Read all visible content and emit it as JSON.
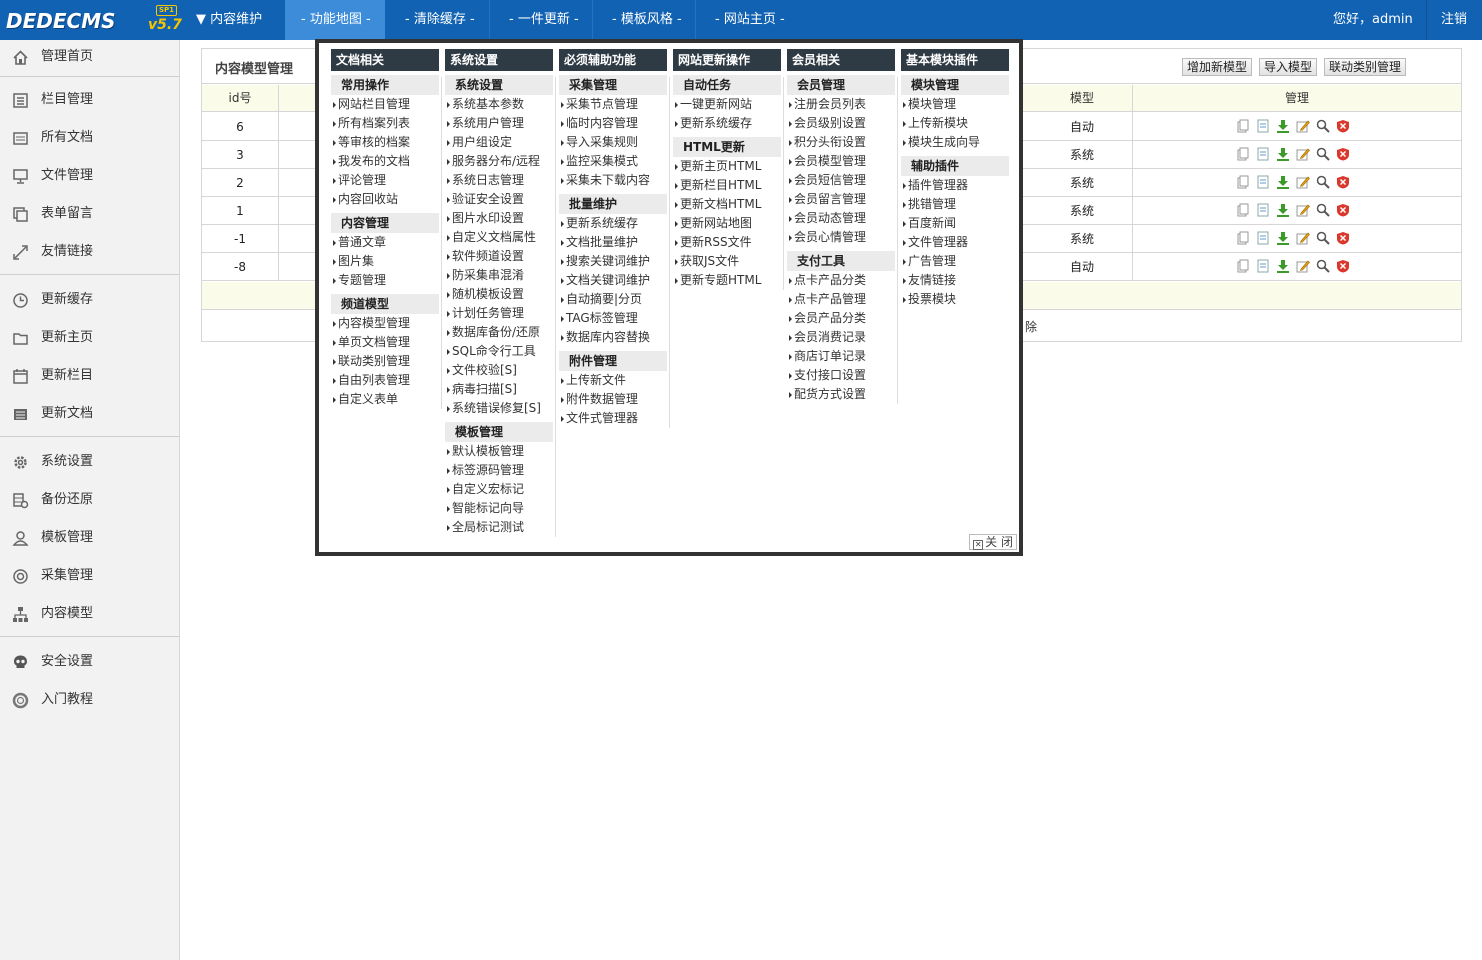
{
  "topbar": {
    "logo_text": "DEDECMS",
    "logo_version": "v5.7",
    "logo_badge": "SP1",
    "nav": [
      {
        "label": "▼ 内容维护",
        "active": false
      },
      {
        "label": "- 功能地图 -",
        "active": true
      },
      {
        "label": "- 清除缓存 -",
        "active": false
      },
      {
        "label": "- 一件更新 -",
        "active": false
      },
      {
        "label": "- 模板风格 -",
        "active": false
      },
      {
        "label": "- 网站主页 -",
        "active": false
      }
    ],
    "greeting": "您好，admin",
    "logout": "注销",
    "colors": {
      "bar": "#1162b3",
      "active": "#3d8cd9"
    }
  },
  "sidebar": {
    "items": [
      {
        "label": "管理首页",
        "icon": "home-icon"
      },
      {
        "label": "栏目管理",
        "icon": "columns-icon"
      },
      {
        "label": "所有文档",
        "icon": "documents-icon"
      },
      {
        "label": "文件管理",
        "icon": "monitor-icon"
      },
      {
        "label": "表单留言",
        "icon": "forms-icon"
      },
      {
        "label": "友情链接",
        "icon": "link-icon"
      },
      {
        "label": "更新缓存",
        "icon": "clock-icon"
      },
      {
        "label": "更新主页",
        "icon": "folder-icon"
      },
      {
        "label": "更新栏目",
        "icon": "calendar-icon"
      },
      {
        "label": "更新文档",
        "icon": "list-icon"
      },
      {
        "label": "系统设置",
        "icon": "gear-icon"
      },
      {
        "label": "备份还原",
        "icon": "database-icon"
      },
      {
        "label": "模板管理",
        "icon": "user-icon"
      },
      {
        "label": "采集管理",
        "icon": "collect-icon"
      },
      {
        "label": "内容模型",
        "icon": "sitemap-icon"
      },
      {
        "label": "安全设置",
        "icon": "skull-icon"
      },
      {
        "label": "入门教程",
        "icon": "help-icon"
      }
    ]
  },
  "main": {
    "title": "内容模型管理",
    "buttons": {
      "add": "增加新模型",
      "import": "导入模型",
      "linkage": "联动类别管理"
    },
    "headers": {
      "id": "id号",
      "model": "模型",
      "manage": "管理"
    },
    "rows": [
      {
        "id": "6",
        "model": "自动"
      },
      {
        "id": "3",
        "model": "系统"
      },
      {
        "id": "2",
        "model": "系统"
      },
      {
        "id": "1",
        "model": "系统"
      },
      {
        "id": "-1",
        "model": "系统"
      },
      {
        "id": "-8",
        "model": "自动"
      }
    ],
    "row_action_icons": [
      "copy-icon",
      "view-icon",
      "download-icon",
      "edit-icon",
      "search-icon",
      "delete-icon"
    ],
    "hidden_fragment": "除"
  },
  "popup": {
    "close_label": "关 闭",
    "columns": [
      {
        "title": "文档相关",
        "groups": [
          {
            "title": "常用操作",
            "items": [
              "网站栏目管理",
              "所有档案列表",
              "等审核的档案",
              "我发布的文档",
              "评论管理",
              "内容回收站"
            ]
          },
          {
            "title": "内容管理",
            "items": [
              "普通文章",
              "图片集",
              "专题管理"
            ]
          },
          {
            "title": "频道模型",
            "items": [
              "内容模型管理",
              "单页文档管理",
              "联动类别管理",
              "自由列表管理",
              "自定义表单"
            ]
          }
        ]
      },
      {
        "title": "系统设置",
        "groups": [
          {
            "title": "系统设置",
            "items": [
              "系统基本参数",
              "系统用户管理",
              "用户组设定",
              "服务器分布/远程",
              "系统日志管理",
              "验证安全设置",
              "图片水印设置",
              "自定义文档属性",
              "软件频道设置",
              "防采集串混淆",
              "随机模板设置",
              "计划任务管理",
              "数据库备份/还原",
              "SQL命令行工具",
              "文件校验[S]",
              "病毒扫描[S]",
              "系统错误修复[S]"
            ]
          },
          {
            "title": "模板管理",
            "items": [
              "默认模板管理",
              "标签源码管理",
              "自定义宏标记",
              "智能标记向导",
              "全局标记测试"
            ]
          }
        ]
      },
      {
        "title": "必须辅助功能",
        "groups": [
          {
            "title": "采集管理",
            "items": [
              "采集节点管理",
              "临时内容管理",
              "导入采集规则",
              "监控采集模式",
              "采集未下载内容"
            ]
          },
          {
            "title": "批量维护",
            "items": [
              "更新系统缓存",
              "文档批量维护",
              "搜索关键词维护",
              "文档关键词维护",
              "自动摘要|分页",
              "TAG标签管理",
              "数据库内容替换"
            ]
          },
          {
            "title": "附件管理",
            "items": [
              "上传新文件",
              "附件数据管理",
              "文件式管理器"
            ]
          }
        ]
      },
      {
        "title": "网站更新操作",
        "groups": [
          {
            "title": "自动任务",
            "items": [
              "一键更新网站",
              "更新系统缓存"
            ]
          },
          {
            "title": "HTML更新",
            "items": [
              "更新主页HTML",
              "更新栏目HTML",
              "更新文档HTML",
              "更新网站地图",
              "更新RSS文件",
              "获取JS文件",
              "更新专题HTML"
            ]
          }
        ]
      },
      {
        "title": "会员相关",
        "groups": [
          {
            "title": "会员管理",
            "items": [
              "注册会员列表",
              "会员级别设置",
              "积分头衔设置",
              "会员模型管理",
              "会员短信管理",
              "会员留言管理",
              "会员动态管理",
              "会员心情管理"
            ]
          },
          {
            "title": "支付工具",
            "items": [
              "点卡产品分类",
              "点卡产品管理",
              "会员产品分类",
              "会员消费记录",
              "商店订单记录",
              "支付接口设置",
              "配货方式设置"
            ]
          }
        ]
      },
      {
        "title": "基本模块插件",
        "groups": [
          {
            "title": "模块管理",
            "items": [
              "模块管理",
              "上传新模块",
              "模块生成向导"
            ]
          },
          {
            "title": "辅助插件",
            "items": [
              "插件管理器",
              "挑错管理",
              "百度新闻",
              "文件管理器",
              "广告管理",
              "友情链接",
              "投票模块"
            ]
          }
        ]
      }
    ]
  }
}
